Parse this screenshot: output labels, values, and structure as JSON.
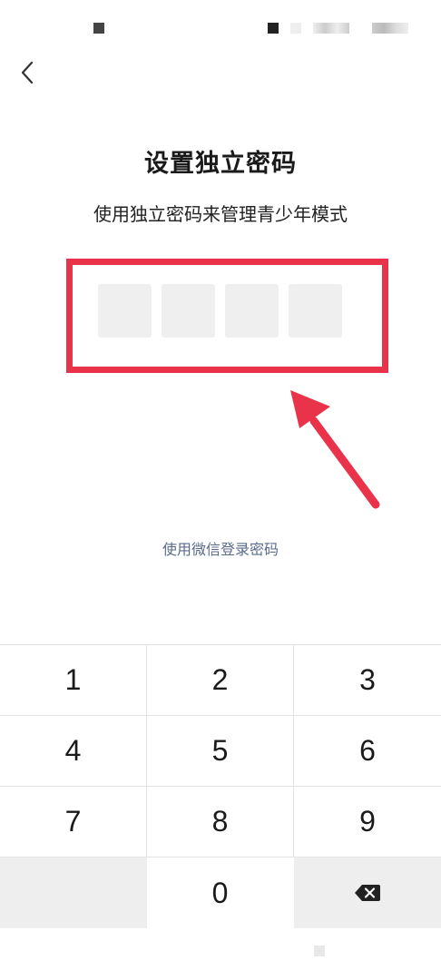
{
  "header": {
    "title": "设置独立密码",
    "subtitle": "使用独立密码来管理青少年模式"
  },
  "pin": {
    "length": 4,
    "entered": 0
  },
  "alt_login": {
    "label": "使用微信登录密码"
  },
  "keypad": {
    "keys": [
      "1",
      "2",
      "3",
      "4",
      "5",
      "6",
      "7",
      "8",
      "9",
      "",
      "0"
    ],
    "delete_icon": "backspace-icon"
  },
  "colors": {
    "highlight": "#e8334a",
    "link": "#5b6b8c",
    "pin_box": "#efefef",
    "key_dark": "#eeeeee"
  },
  "icons": {
    "back": "chevron-left-icon",
    "delete": "backspace-icon",
    "annotation": "arrow-icon"
  }
}
